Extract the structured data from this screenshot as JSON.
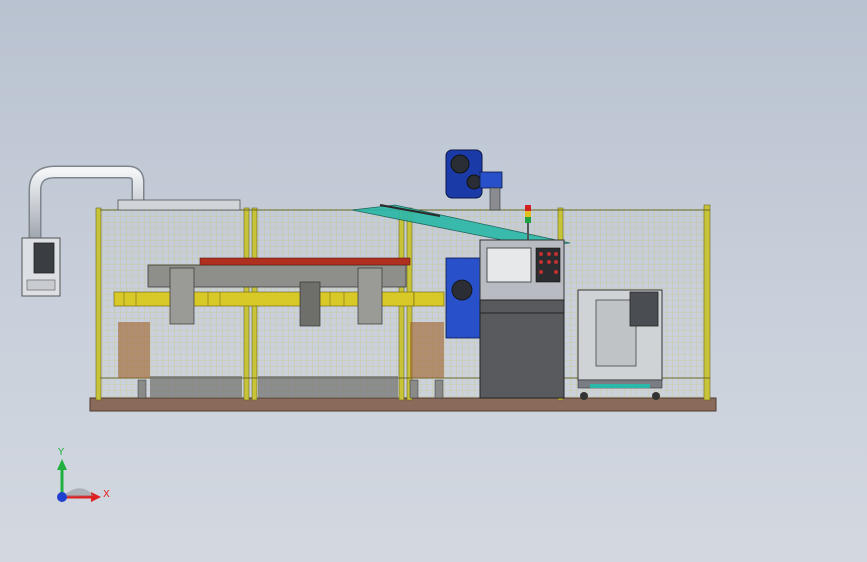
{
  "viewport": {
    "background_top": "#b9c2d0",
    "background_bottom": "#d3d8e0"
  },
  "triad": {
    "x_label": "X",
    "y_label": "Y",
    "x_color": "#e02020",
    "y_color": "#20b040",
    "z_color": "#2040d0"
  },
  "model": {
    "fence_color": "#c8c43a",
    "base_color": "#8a6a5a",
    "robot_color": "#1a3aa8",
    "guard_color": "#2ab8a8",
    "icons": [
      "robot-arm",
      "control-cabinet",
      "operator-terminal",
      "cart-machine",
      "signal-tower",
      "duct-pipe"
    ]
  }
}
